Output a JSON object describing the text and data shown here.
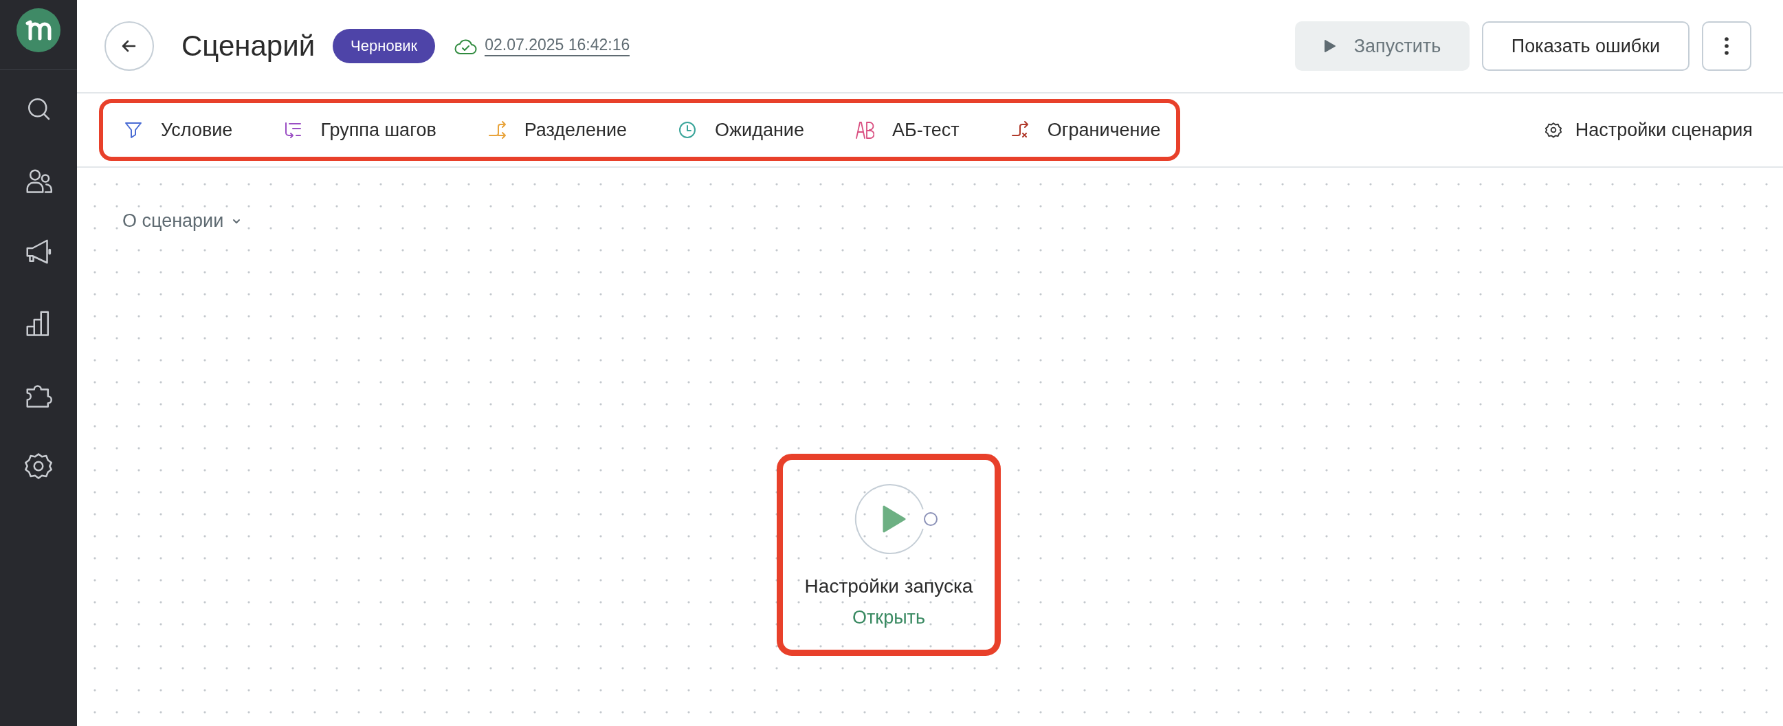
{
  "sidebar": {
    "items": [
      {
        "kind": "search"
      },
      {
        "kind": "people"
      },
      {
        "kind": "megaphone"
      },
      {
        "kind": "chart"
      },
      {
        "kind": "puzzle"
      },
      {
        "kind": "settings"
      }
    ]
  },
  "header": {
    "title": "Сценарий",
    "status_badge": "Черновик",
    "saved_time": "02.07.2025 16:42:16"
  },
  "actions": [
    {
      "kind": "run",
      "label": "Запустить",
      "disabled": true
    },
    {
      "kind": "plain",
      "label": "Показать ошибки"
    },
    {
      "kind": "more"
    }
  ],
  "toolbar": {
    "items": [
      {
        "kind": "condition",
        "label": "Условие"
      },
      {
        "kind": "group",
        "label": "Группа шагов"
      },
      {
        "kind": "split",
        "label": "Разделение"
      },
      {
        "kind": "wait",
        "label": "Ожидание"
      },
      {
        "kind": "ab",
        "label": "АБ-тест"
      },
      {
        "kind": "limit",
        "label": "Ограничение"
      }
    ],
    "settings_link": "Настройки сценария"
  },
  "canvas": {
    "about_toggle": "О сценарии",
    "node": {
      "title": "Настройки запуска",
      "action": "Открыть"
    }
  }
}
